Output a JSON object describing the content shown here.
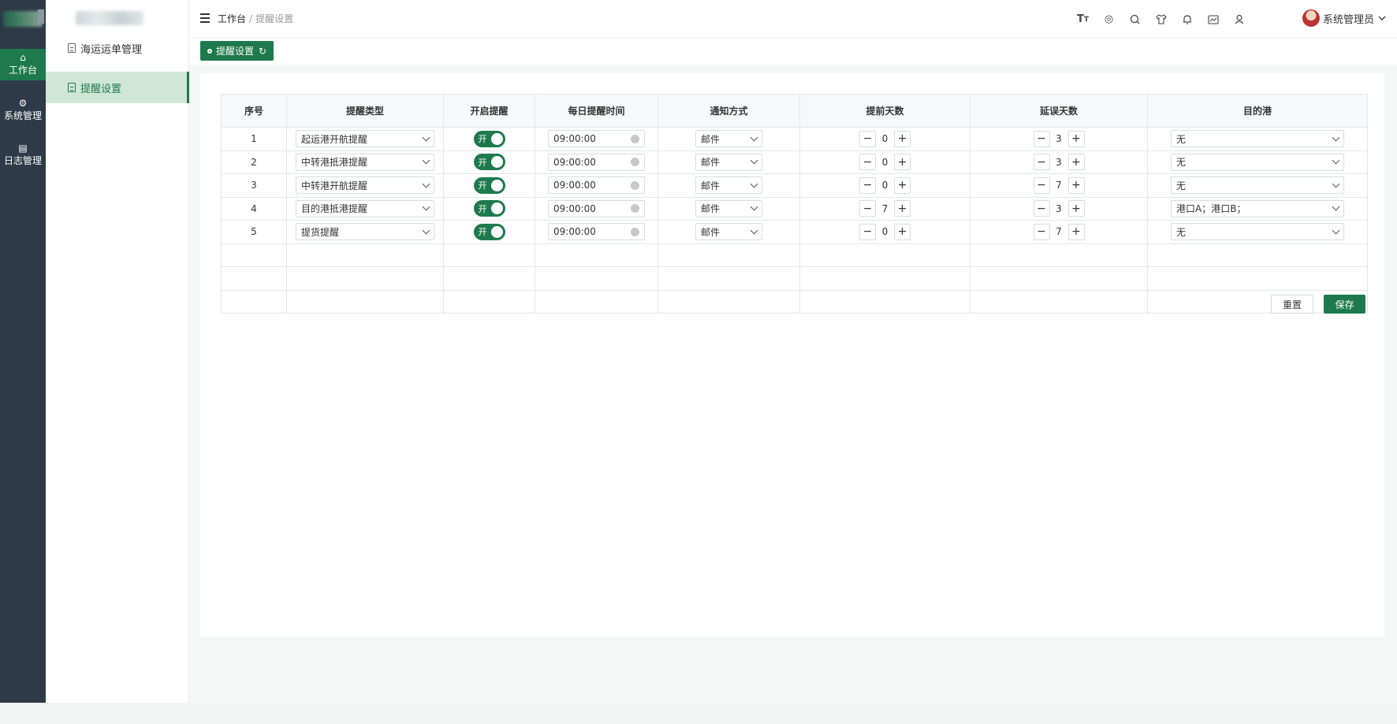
{
  "rail": {
    "items": [
      {
        "label": "工作台",
        "icon": "home-icon"
      },
      {
        "label": "系统管理",
        "icon": "gear-icon"
      },
      {
        "label": "日志管理",
        "icon": "document-icon"
      }
    ]
  },
  "subnav": {
    "items": [
      {
        "label": "海运运单管理"
      },
      {
        "label": "提醒设置"
      }
    ]
  },
  "header": {
    "breadcrumb_home": "工作台",
    "breadcrumb_sep": "/",
    "breadcrumb_current": "提醒设置",
    "user_name": "系统管理员",
    "icons": [
      "font-size-icon",
      "target-icon",
      "search-icon",
      "shirt-icon",
      "bell-icon",
      "chart-icon",
      "user-icon"
    ]
  },
  "tagbar": {
    "tag_label": "提醒设置"
  },
  "table": {
    "columns": [
      "序号",
      "提醒类型",
      "开启提醒",
      "每日提醒时间",
      "通知方式",
      "提前天数",
      "延误天数",
      "目的港"
    ],
    "rows": [
      {
        "no": "1",
        "type": "起运港开航提醒",
        "toggle": "开",
        "time": "09:00:00",
        "notify": "邮件",
        "advance": "0",
        "delay": "3",
        "port": "无"
      },
      {
        "no": "2",
        "type": "中转港抵港提醒",
        "toggle": "开",
        "time": "09:00:00",
        "notify": "邮件",
        "advance": "0",
        "delay": "3",
        "port": "无"
      },
      {
        "no": "3",
        "type": "中转港开航提醒",
        "toggle": "开",
        "time": "09:00:00",
        "notify": "邮件",
        "advance": "0",
        "delay": "7",
        "port": "无"
      },
      {
        "no": "4",
        "type": "目的港抵港提醒",
        "toggle": "开",
        "time": "09:00:00",
        "notify": "邮件",
        "advance": "7",
        "delay": "3",
        "port": "港口A；港口B；"
      },
      {
        "no": "5",
        "type": "提货提醒",
        "toggle": "开",
        "time": "09:00:00",
        "notify": "邮件",
        "advance": "0",
        "delay": "7",
        "port": "无"
      }
    ],
    "empty_rows": 3
  },
  "actions": {
    "reset_label": "重置",
    "save_label": "保存"
  },
  "colors": {
    "accent": "#1e7a4c",
    "rail_bg": "#2e3a47",
    "active_sub_bg": "#cfe6d8"
  }
}
